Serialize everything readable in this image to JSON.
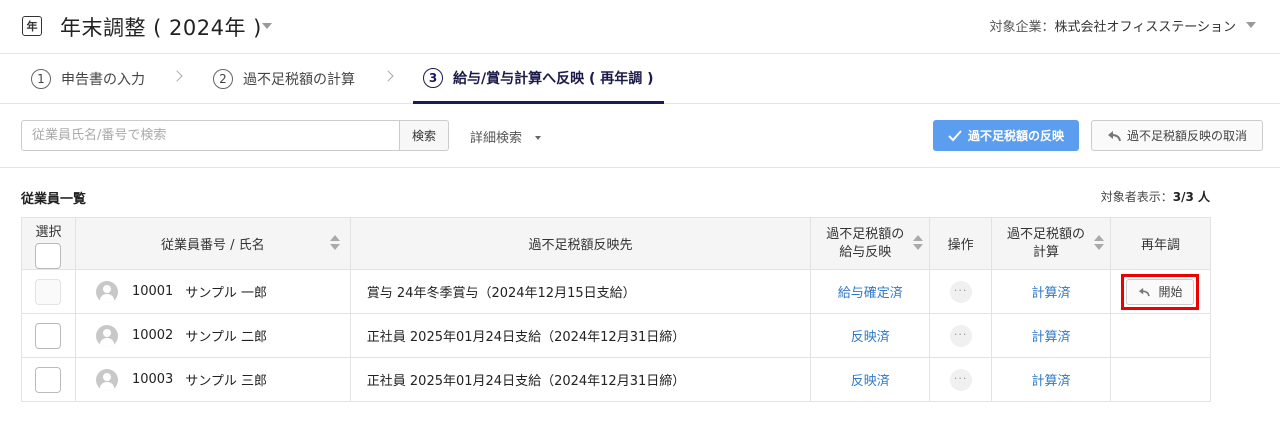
{
  "header": {
    "app_icon": "年",
    "title": "年末調整 ( 2024年 )",
    "company_label": "対象企業：",
    "company_name": "株式会社オフィスステーション"
  },
  "steps": [
    {
      "num": "1",
      "label": "申告書の入力"
    },
    {
      "num": "2",
      "label": "過不足税額の計算"
    },
    {
      "num": "3",
      "label": "給与/賞与計算へ反映 ( 再年調 )"
    }
  ],
  "toolbar": {
    "search_placeholder": "従業員氏名/番号で検索",
    "search_button": "検索",
    "advanced_search": "詳細検索",
    "apply_button": "過不足税額の反映",
    "cancel_button": "過不足税額反映の取消"
  },
  "section": {
    "title": "従業員一覧",
    "count_label": "対象者表示：",
    "count_value": "3/3 人"
  },
  "table": {
    "headers": {
      "select": "選択",
      "employee": "従業員番号 / 氏名",
      "destination": "過不足税額反映先",
      "salary_line1": "過不足税額の",
      "salary_line2": "給与反映",
      "operation": "操作",
      "calc_line1": "過不足税額の",
      "calc_line2": "計算",
      "redo": "再年調"
    },
    "rows": [
      {
        "id": "10001",
        "name": "サンプル 一郎",
        "destination": "賞与 24年冬季賞与（2024年12月15日支給）",
        "salary_status": "給与確定済",
        "op": "···",
        "calc_status": "計算済",
        "redo_action": "開始"
      },
      {
        "id": "10002",
        "name": "サンプル 二郎",
        "destination": "正社員 2025年01月24日支給（2024年12月31日締）",
        "salary_status": "反映済",
        "op": "···",
        "calc_status": "計算済",
        "redo_action": ""
      },
      {
        "id": "10003",
        "name": "サンプル 三郎",
        "destination": "正社員 2025年01月24日支給（2024年12月31日締）",
        "salary_status": "反映済",
        "op": "···",
        "calc_status": "計算済",
        "redo_action": ""
      }
    ]
  },
  "colors": {
    "accent": "#5b9ef0",
    "link": "#2f78c8",
    "active_step": "#1b1b5b",
    "highlight": "#e00000"
  }
}
